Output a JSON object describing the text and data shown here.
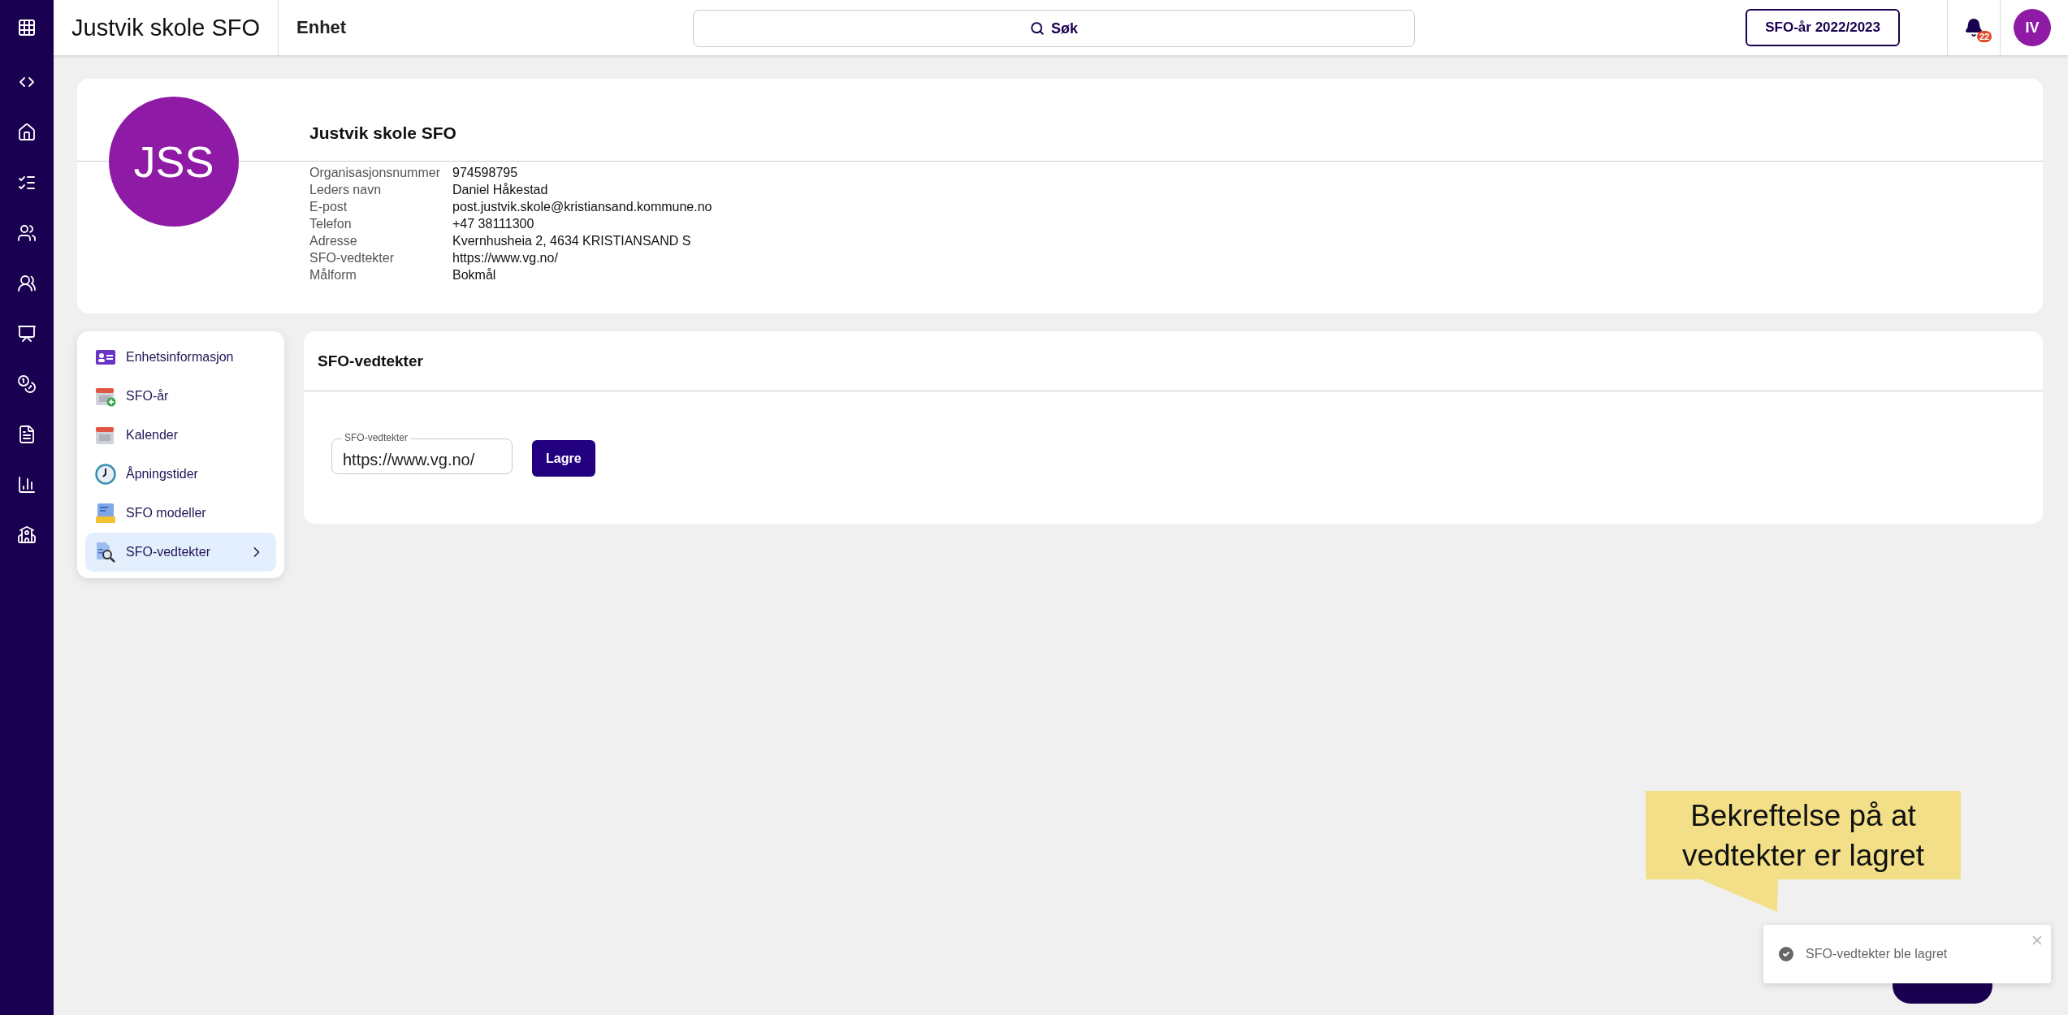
{
  "app_bar": {
    "title": "Justvik skole SFO",
    "section": "Enhet",
    "search_placeholder": "Søk",
    "year_button": "SFO-år 2022/2023",
    "notification_count": "22",
    "user_initials": "IV"
  },
  "unit": {
    "initials": "JSS",
    "name": "Justvik skole SFO",
    "details": [
      {
        "label": "Organisasjonsnummer",
        "value": "974598795"
      },
      {
        "label": "Leders navn",
        "value": "Daniel Håkestad"
      },
      {
        "label": "E-post",
        "value": "post.justvik.skole@kristiansand.kommune.no"
      },
      {
        "label": "Telefon",
        "value": "+47 38111300"
      },
      {
        "label": "Adresse",
        "value": "Kvernhusheia 2, 4634 KRISTIANSAND S"
      },
      {
        "label": "SFO-vedtekter",
        "value": "https://www.vg.no/"
      },
      {
        "label": "Målform",
        "value": "Bokmål"
      }
    ]
  },
  "menu": [
    {
      "label": "Enhetsinformasjon",
      "selected": false
    },
    {
      "label": "SFO-år",
      "selected": false
    },
    {
      "label": "Kalender",
      "selected": false
    },
    {
      "label": "Åpningstider",
      "selected": false
    },
    {
      "label": "SFO modeller",
      "selected": false
    },
    {
      "label": "SFO-vedtekter",
      "selected": true
    }
  ],
  "panel": {
    "title": "SFO-vedtekter",
    "field": {
      "label": "SFO-vedtekter",
      "value": "https://www.vg.no/"
    },
    "save_button": "Lagre"
  },
  "callout": "Bekreftelse på at\nvedtekter er lagret",
  "toast": {
    "message": "SFO-vedtekter ble lagret"
  }
}
